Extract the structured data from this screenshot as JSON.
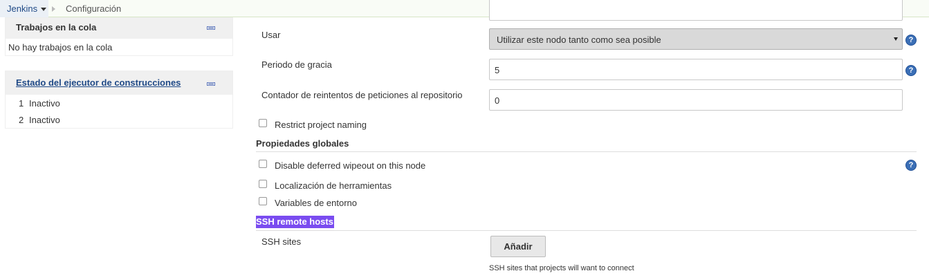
{
  "breadcrumb": {
    "root_label": "Jenkins",
    "current_label": "Configuración"
  },
  "queue_pane": {
    "title": "Trabajos en la cola",
    "empty_text": "No hay trabajos en la cola"
  },
  "executor_pane": {
    "title": "Estado del ejecutor de construcciones",
    "executors": [
      {
        "number": "1",
        "status": "Inactivo"
      },
      {
        "number": "2",
        "status": "Inactivo"
      }
    ]
  },
  "form": {
    "usage": {
      "label": "Usar",
      "value": "Utilizar este nodo tanto como sea posible"
    },
    "grace_period": {
      "label": "Periodo de gracia",
      "value": "5"
    },
    "retry_count": {
      "label": "Contador de reintentos de peticiones al repositorio",
      "value": "0"
    },
    "restrict_naming": {
      "label": "Restrict project naming",
      "checked": false
    }
  },
  "global_properties": {
    "title": "Propiedades globales",
    "options": [
      {
        "label": "Disable deferred wipeout on this node",
        "checked": false
      },
      {
        "label": "Localización de herramientas",
        "checked": false
      },
      {
        "label": "Variables de entorno",
        "checked": false
      }
    ]
  },
  "ssh": {
    "section_title": "SSH remote hosts",
    "sites_label": "SSH sites",
    "add_button": "Añadir",
    "description": "SSH sites that projects will want to connect"
  },
  "help_glyph": "?",
  "colors": {
    "link": "#204a87",
    "breadcrumb_bg": "#f9fcf6",
    "selection_highlight": "#7a4cf0",
    "help_icon": "#3b6fb6"
  }
}
